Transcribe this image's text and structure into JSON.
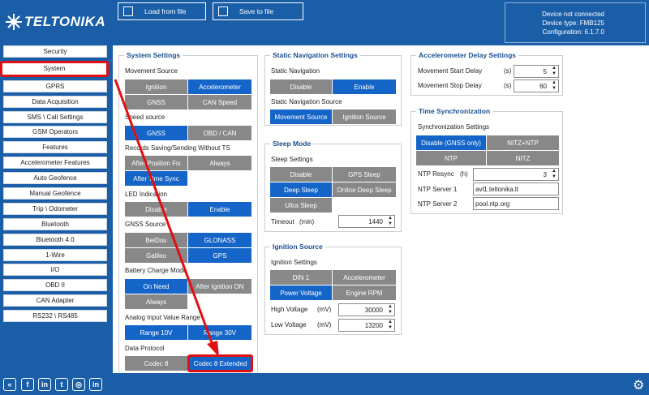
{
  "brand": "TELTONIKA",
  "toolbar": {
    "load_label": "Load from file",
    "save_label": "Save to file"
  },
  "device": {
    "status": "Device not connected",
    "type": "Device type: FMB125",
    "config": "Configuration: 6.1.7.0"
  },
  "sidebar": {
    "items": [
      {
        "label": "Security"
      },
      {
        "label": "System"
      },
      {
        "label": "GPRS"
      },
      {
        "label": "Data Acquisition"
      },
      {
        "label": "SMS \\ Call Settings"
      },
      {
        "label": "GSM Operators"
      },
      {
        "label": "Features"
      },
      {
        "label": "Accelerometer Features"
      },
      {
        "label": "Auto Geofence"
      },
      {
        "label": "Manual Geofence"
      },
      {
        "label": "Trip \\ Odometer"
      },
      {
        "label": "Bluetooth"
      },
      {
        "label": "Bluetooth 4.0"
      },
      {
        "label": "1-Wire"
      },
      {
        "label": "I/O"
      },
      {
        "label": "OBD II"
      },
      {
        "label": "CAN Adapter"
      },
      {
        "label": "RS232 \\ RS485"
      }
    ]
  },
  "system": {
    "title": "System Settings",
    "movement_source": {
      "label": "Movement Source",
      "ignition": "Ignition",
      "accelerometer": "Accelerometer",
      "gnss": "GNSS",
      "can_speed": "CAN Speed"
    },
    "speed_source": {
      "label": "Speed source",
      "gnss": "GNSS",
      "obd": "OBD / CAN"
    },
    "records": {
      "label": "Records Saving/Sending Without TS",
      "after_fix": "After Position Fix",
      "always": "Always",
      "after_sync": "After Time Sync"
    },
    "led": {
      "label": "LED Indication",
      "disable": "Disable",
      "enable": "Enable"
    },
    "gnss_source": {
      "label": "GNSS Source",
      "beidou": "BeiDou",
      "glonass": "GLONASS",
      "galileo": "Galileo",
      "gps": "GPS"
    },
    "battery": {
      "label": "Battery Charge Mode",
      "on_need": "On Need",
      "after_ign": "After Ignition ON",
      "always": "Always"
    },
    "analog": {
      "label": "Analog Input Value Range",
      "r10": "Range 10V",
      "r30": "Range 30V"
    },
    "protocol": {
      "label": "Data Protocol",
      "codec8": "Codec 8",
      "codec8e": "Codec 8 Extended"
    }
  },
  "static_nav": {
    "title": "Static Navigation Settings",
    "label": "Static Navigation",
    "disable": "Disable",
    "enable": "Enable",
    "source_label": "Static Navigation Source",
    "movement": "Movement Source",
    "ignition": "Ignition Source"
  },
  "sleep": {
    "title": "Sleep Mode",
    "label": "Sleep Settings",
    "disable": "Disable",
    "gps_sleep": "GPS Sleep",
    "deep_sleep": "Deep Sleep",
    "online_deep": "Online Deep Sleep",
    "ultra": "Ultra Sleep",
    "timeout_label": "Timeout",
    "timeout_unit": "(min)",
    "timeout_value": "1440"
  },
  "ignition": {
    "title": "Ignition Source",
    "label": "Ignition Settings",
    "din1": "DIN 1",
    "accelerometer": "Accelerometer",
    "power_voltage": "Power Voltage",
    "engine_rpm": "Engine RPM",
    "high_label": "High Voltage",
    "high_unit": "(mV)",
    "high_value": "30000",
    "low_label": "Low Voltage",
    "low_unit": "(mV)",
    "low_value": "13200"
  },
  "accel_delay": {
    "title": "Accelerometer Delay Settings",
    "start_label": "Movement Start Delay",
    "start_unit": "(s)",
    "start_value": "5",
    "stop_label": "Movement Stop Delay",
    "stop_unit": "(s)",
    "stop_value": "60"
  },
  "time_sync": {
    "title": "Time Synchronization",
    "label": "Synchronization Settings",
    "disable": "Disable (GNSS only)",
    "nitz_ntp": "NITZ+NTP",
    "ntp": "NTP",
    "nitz": "NITZ",
    "resync_label": "NTP Resync",
    "resync_unit": "(h)",
    "resync_value": "3",
    "server1_label": "NTP Server 1",
    "server1_value": "avl1.teltonika.lt",
    "server2_label": "NTP Server 2",
    "server2_value": "pool.ntp.org"
  },
  "social": {
    "icons": [
      "double-arrow-icon",
      "facebook-icon",
      "linkedin-icon",
      "twitter-icon",
      "instagram-icon",
      "linkedin-icon"
    ]
  },
  "colors": {
    "brand": "#1a5ea8",
    "selected": "#1565c8",
    "unselected": "#888888",
    "highlight": "#e01010"
  }
}
